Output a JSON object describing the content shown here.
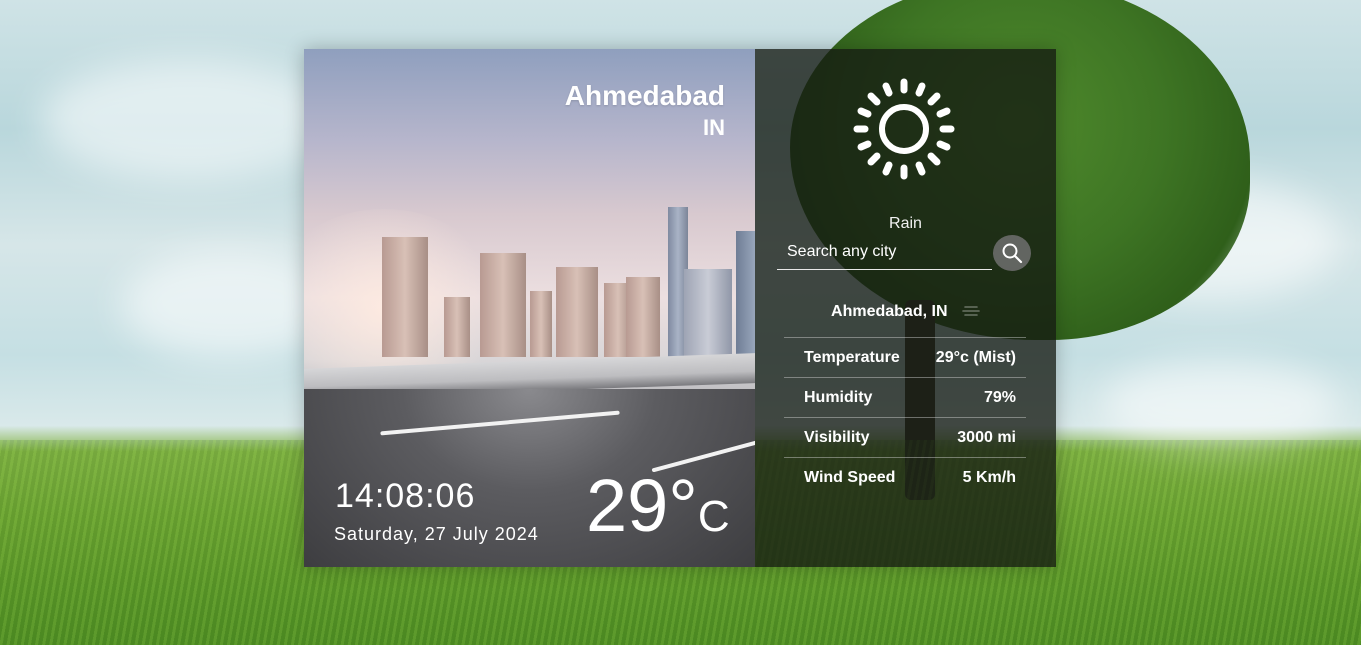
{
  "location": {
    "city": "Ahmedabad",
    "country": "IN",
    "full": "Ahmedabad, IN"
  },
  "clock": {
    "time": "14:08:06",
    "date": "Saturday, 27 July 2024"
  },
  "temperature": {
    "value": "29°",
    "unit": "C"
  },
  "weather": {
    "icon": "sun-icon",
    "condition": "Rain"
  },
  "search": {
    "placeholder": "Search any city",
    "button_icon": "search-icon"
  },
  "stats": [
    {
      "label": "Temperature",
      "value": "29°c (Mist)"
    },
    {
      "label": "Humidity",
      "value": "79%"
    },
    {
      "label": "Visibility",
      "value": "3000 mi"
    },
    {
      "label": "Wind Speed",
      "value": "5 Km/h"
    }
  ],
  "colors": {
    "panel_overlay": "#141912",
    "text": "#ffffff"
  }
}
